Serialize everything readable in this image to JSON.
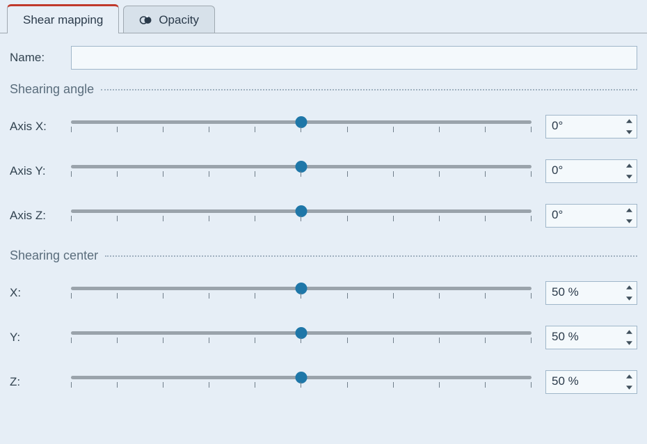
{
  "tabs": {
    "shear": "Shear mapping",
    "opacity": "Opacity"
  },
  "name_label": "Name:",
  "name_value": "",
  "sections": {
    "angle": {
      "title": "Shearing angle",
      "rows": [
        {
          "label": "Axis X:",
          "value": "0°"
        },
        {
          "label": "Axis Y:",
          "value": "0°"
        },
        {
          "label": "Axis Z:",
          "value": "0°"
        }
      ]
    },
    "center": {
      "title": "Shearing center",
      "rows": [
        {
          "label": "X:",
          "value": "50 %"
        },
        {
          "label": "Y:",
          "value": "50 %"
        },
        {
          "label": "Z:",
          "value": "50 %"
        }
      ]
    }
  }
}
